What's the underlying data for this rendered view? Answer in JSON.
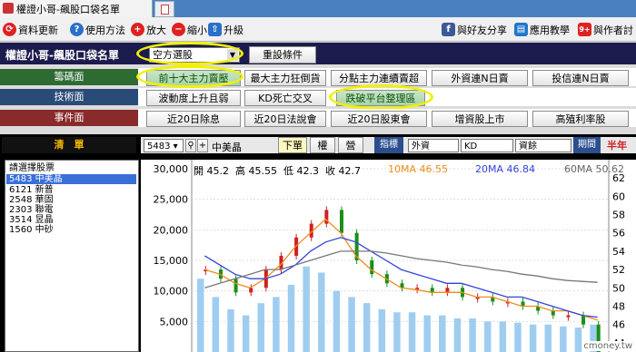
{
  "window": {
    "tab_title": "權證小哥-飆股口袋名單",
    "new_tab_icon": "new-tab-icon"
  },
  "toolbar": {
    "refresh": "資料更新",
    "help": "使用方法",
    "zoom_in": "放大",
    "zoom_out": "縮小",
    "upgrade": "升級",
    "share": "與好友分享",
    "teach": "應用教學",
    "chat": "與作者討",
    "notify_badge": "9+"
  },
  "header": {
    "title": "權證小哥-飆股口袋名單",
    "strategy": "空方選股",
    "reset": "重設條件"
  },
  "categories": [
    {
      "label": "籌碼面",
      "color": "#2e6b33",
      "buttons": [
        "前十大主力賣壓",
        "最大主力狂倒貨",
        "分點主力連續賣超",
        "外資連N日賣",
        "投信連N日賣"
      ]
    },
    {
      "label": "技術面",
      "color": "#2a4a78",
      "buttons": [
        "波動度上升且弱",
        "KD死亡交叉",
        "跌破平台整理區"
      ]
    },
    {
      "label": "事件面",
      "color": "#8a2b2b",
      "buttons": [
        "近20日除息",
        "近20日法說會",
        "近20日股東會",
        "增資股上市",
        "高殖利率股"
      ]
    }
  ],
  "list": {
    "header": "清　單",
    "items": [
      "請選擇股票",
      "5483 中美晶",
      "6121 新普",
      "2548 華固",
      "2303 聯電",
      "3514 昱晶",
      "1560 中砂"
    ],
    "selected_index": 1
  },
  "controls": {
    "stock_code": "5483",
    "stock_name": "中美晶",
    "tabs": [
      "下單",
      "權",
      "營"
    ],
    "indicator_label": "指標",
    "indicator_value": "外資",
    "period_value": "KD",
    "data_value": "資餘",
    "period_label": "期間",
    "range": "半年"
  },
  "chart_data": {
    "type": "line",
    "title": "",
    "info": {
      "open_label": "開",
      "open": "45.2",
      "high_label": "高",
      "high": "45.55",
      "low_label": "低",
      "low": "42.3",
      "close_label": "收",
      "close": "42.7",
      "ma10_label": "10MA",
      "ma10": "46.55",
      "ma20_label": "20MA",
      "ma20": "46.84",
      "ma60_label": "60MA",
      "ma60": "50.62"
    },
    "left_axis": {
      "ticks": [
        "30,000",
        "25,000",
        "20,000",
        "15,000",
        "10,000",
        "5,000"
      ],
      "ylim": [
        0,
        30000
      ]
    },
    "right_axis": {
      "ticks": [
        "62",
        "60",
        "58",
        "56",
        "54",
        "52",
        "50",
        "48",
        "46",
        "44"
      ],
      "ylim": [
        43,
        63
      ]
    },
    "series": [
      {
        "name": "10MA",
        "color": "#f08c1e",
        "values": [
          52,
          51.5,
          50.5,
          50,
          51,
          52.5,
          54.5,
          56,
          57.5,
          56,
          53.5,
          52,
          51,
          50,
          49.8,
          49.5,
          49.5,
          49.5,
          49,
          49,
          48.5,
          48,
          48,
          47.5,
          47.5,
          47,
          46.5
        ]
      },
      {
        "name": "20MA",
        "color": "#3444d8",
        "values": [
          53.5,
          52.5,
          51.5,
          51,
          51,
          51.5,
          52.5,
          54,
          55,
          55.5,
          55,
          54,
          53,
          52,
          51.5,
          51,
          50.5,
          50.5,
          50,
          49.5,
          49,
          49,
          48.5,
          48,
          47.5,
          47,
          46.8
        ]
      },
      {
        "name": "60MA",
        "color": "#777777",
        "values": [
          50,
          50.5,
          51,
          51.5,
          52,
          52,
          52.5,
          53,
          53.5,
          54,
          54,
          54,
          53.8,
          53.5,
          53.2,
          53,
          52.8,
          52.5,
          52.3,
          52,
          51.8,
          51.5,
          51.3,
          51,
          50.8,
          50.7,
          50.6
        ]
      }
    ],
    "closes": [
      52,
      51,
      49.5,
      50,
      52,
      53.5,
      55.5,
      57,
      58.5,
      56,
      53,
      51.5,
      50.5,
      50,
      50,
      49.5,
      50,
      49,
      49,
      48.5,
      48.5,
      48,
      47.5,
      47,
      47,
      46,
      42.7
    ],
    "volume": [
      12000,
      9000,
      7000,
      6000,
      8000,
      9000,
      11000,
      14000,
      13000,
      10000,
      9000,
      8000,
      7000,
      6500,
      6500,
      6000,
      6000,
      5500,
      5500,
      5000,
      5000,
      4800,
      4500,
      4500,
      4200,
      4000,
      4500
    ]
  },
  "watermark": "cmoney.tw"
}
